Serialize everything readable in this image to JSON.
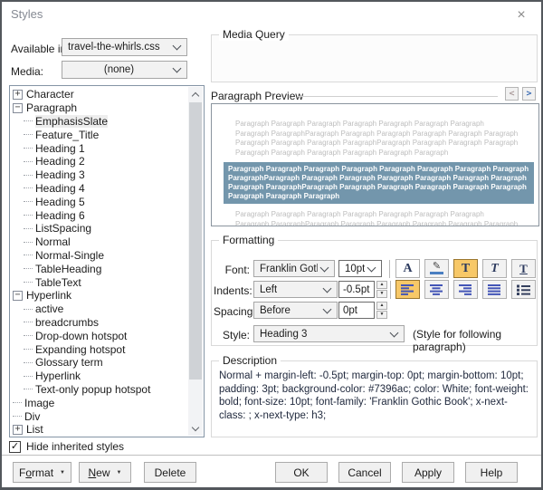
{
  "window": {
    "title": "Styles"
  },
  "icons": {
    "close": "×",
    "check": "✓",
    "prev": "<",
    "next": ">",
    "spinner_up": "▲",
    "spinner_down": "▼",
    "expand": "+",
    "collapse": "−",
    "font_color": "A",
    "highlight": "✎",
    "bold": "T",
    "italic": "T",
    "underline": "T"
  },
  "colors": {
    "band_bg": "#7396ac",
    "band_text": "#ffffff",
    "toggle_active_bg": "#f7c868",
    "toggle_active_border": "#9a762f",
    "accent_blue": "#4456b7",
    "preview_gray": "#bdbdbd"
  },
  "available_in": {
    "label": "Available in:",
    "value": "travel-the-whirls.css"
  },
  "media": {
    "label": "Media:",
    "value": "(none)"
  },
  "tree": {
    "items": [
      {
        "label": "Character",
        "level": 0,
        "expander": "plus"
      },
      {
        "label": "Paragraph",
        "level": 0,
        "expander": "minus"
      },
      {
        "label": "EmphasisSlate",
        "level": 1,
        "selected": true
      },
      {
        "label": "Feature_Title",
        "level": 1
      },
      {
        "label": "Heading 1",
        "level": 1
      },
      {
        "label": "Heading 2",
        "level": 1
      },
      {
        "label": "Heading 3",
        "level": 1
      },
      {
        "label": "Heading 4",
        "level": 1
      },
      {
        "label": "Heading 5",
        "level": 1
      },
      {
        "label": "Heading 6",
        "level": 1
      },
      {
        "label": "ListSpacing",
        "level": 1
      },
      {
        "label": "Normal",
        "level": 1
      },
      {
        "label": "Normal-Single",
        "level": 1
      },
      {
        "label": "TableHeading",
        "level": 1
      },
      {
        "label": "TableText",
        "level": 1
      },
      {
        "label": "Hyperlink",
        "level": 0,
        "expander": "minus"
      },
      {
        "label": "active",
        "level": 1
      },
      {
        "label": "breadcrumbs",
        "level": 1
      },
      {
        "label": "Drop-down hotspot",
        "level": 1
      },
      {
        "label": "Expanding hotspot",
        "level": 1
      },
      {
        "label": "Glossary term",
        "level": 1
      },
      {
        "label": "Hyperlink",
        "level": 1
      },
      {
        "label": "Text-only popup hotspot",
        "level": 1
      },
      {
        "label": "Image",
        "level": 0
      },
      {
        "label": "Div",
        "level": 0
      },
      {
        "label": "List",
        "level": 0,
        "expander": "plus"
      }
    ]
  },
  "hide_inherited": {
    "label": "Hide inherited styles",
    "checked": true
  },
  "media_query": {
    "label": "Media Query"
  },
  "preview": {
    "label": "Paragraph Preview",
    "gray_top": "Paragraph Paragraph Paragraph Paragraph Paragraph Paragraph Paragraph Paragraph ParagraphParagraph Paragraph Paragraph Paragraph Paragraph Paragraph Paragraph Paragraph Paragraph ParagraphParagraph Paragraph Paragraph Paragraph Paragraph Paragraph Paragraph Paragraph Paragraph Paragraph",
    "selected": "Paragraph Paragraph Paragraph Paragraph Paragraph Paragraph Paragraph Paragraph ParagraphParagraph Paragraph Paragraph Paragraph Paragraph Paragraph Paragraph Paragraph ParagraphParagraph Paragraph Paragraph Paragraph Paragraph Paragraph Paragraph Paragraph Paragraph",
    "gray_bottom": "Paragraph Paragraph Paragraph Paragraph Paragraph Paragraph Paragraph Paragraph ParagraphParagraph Paragraph Paragraph Paragraph Paragraph Paragraph Paragraph Paragraph Paragraph ParagraphParagraph Paragraph Paragraph Paragraph Paragraph Paragraph Paragraph Paragraph Paragraph Paragraph"
  },
  "formatting": {
    "label": "Formatting",
    "font_label": "Font:",
    "font_value": "Franklin Gothic B",
    "size_value": "10pt",
    "indents_label": "Indents:",
    "indents_value": "Left",
    "indents_amount": "-0.5pt",
    "spacing_label": "Spacing:",
    "spacing_value": "Before",
    "spacing_amount": "0pt",
    "style_label": "Style:",
    "style_value": "Heading 3",
    "style_note": "(Style for following paragraph)"
  },
  "description": {
    "label": "Description",
    "text": "Normal + margin-left: -0.5pt; margin-top: 0pt; margin-bottom: 10pt; padding: 3pt; background-color: #7396ac; color: White; font-weight: bold; font-size: 10pt; font-family: 'Franklin Gothic Book'; x-next-class: ; x-next-type: h3;"
  },
  "footer": {
    "left": [
      {
        "name": "format",
        "label": "Format",
        "mnemonic": "o",
        "dropdown": true
      },
      {
        "name": "new",
        "label": "New",
        "mnemonic": "N",
        "dropdown": true
      },
      {
        "name": "delete",
        "label": "Delete"
      }
    ],
    "right": [
      {
        "name": "ok",
        "label": "OK"
      },
      {
        "name": "cancel",
        "label": "Cancel"
      },
      {
        "name": "apply",
        "label": "Apply"
      },
      {
        "name": "help",
        "label": "Help"
      }
    ]
  }
}
